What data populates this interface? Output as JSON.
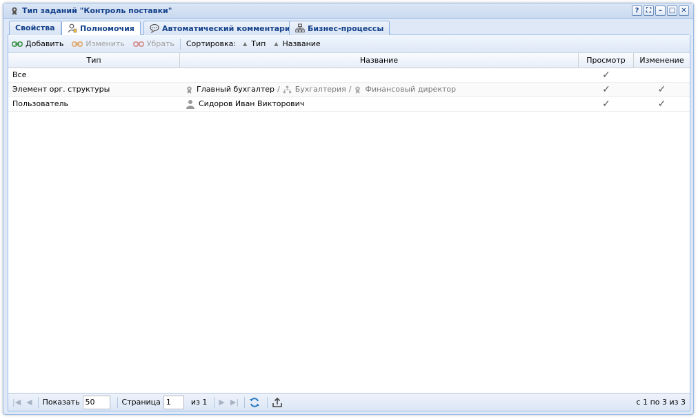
{
  "window": {
    "title": "Тип заданий \"Контроль поставки\"",
    "tools": [
      "?",
      "⛶",
      "–",
      "□",
      "✕"
    ]
  },
  "tabs": [
    {
      "label": "Свойства",
      "icon": "none"
    },
    {
      "label": "Полномочия",
      "icon": "user-badge-icon",
      "active": true
    },
    {
      "label": "Автоматический комментарий",
      "icon": "speech-bubble-icon"
    },
    {
      "label": "Бизнес-процессы",
      "icon": "org-chart-icon"
    }
  ],
  "toolbar": {
    "add_label": "Добавить",
    "edit_label": "Изменить",
    "remove_label": "Убрать",
    "sort_label": "Сортировка:",
    "sort_type_label": "Тип",
    "sort_name_label": "Название"
  },
  "grid": {
    "columns": [
      "Тип",
      "Название",
      "Просмотр",
      "Изменение"
    ],
    "rows": [
      {
        "type": "Все",
        "name_parts": [],
        "view": "✓",
        "edit": ""
      },
      {
        "type": "Элемент орг. структуры",
        "name_parts": [
          "Главный бухгалтер",
          "Бухгалтерия",
          "Финансовый директор"
        ],
        "view": "✓",
        "edit": "✓"
      },
      {
        "type": "Пользователь",
        "name_parts": [
          "Сидоров Иван Викторович"
        ],
        "view": "✓",
        "edit": "✓"
      }
    ]
  },
  "paging": {
    "show_label": "Показать",
    "page_size": "50",
    "page_label": "Страница",
    "page_value": "1",
    "of_label": "из 1",
    "info": "с 1 по 3 из 3"
  },
  "colors": {
    "title": "#15428b",
    "border": "#99bbe8",
    "add_icon": "#2e8b3a",
    "disabled_icon": "#e0a060"
  }
}
